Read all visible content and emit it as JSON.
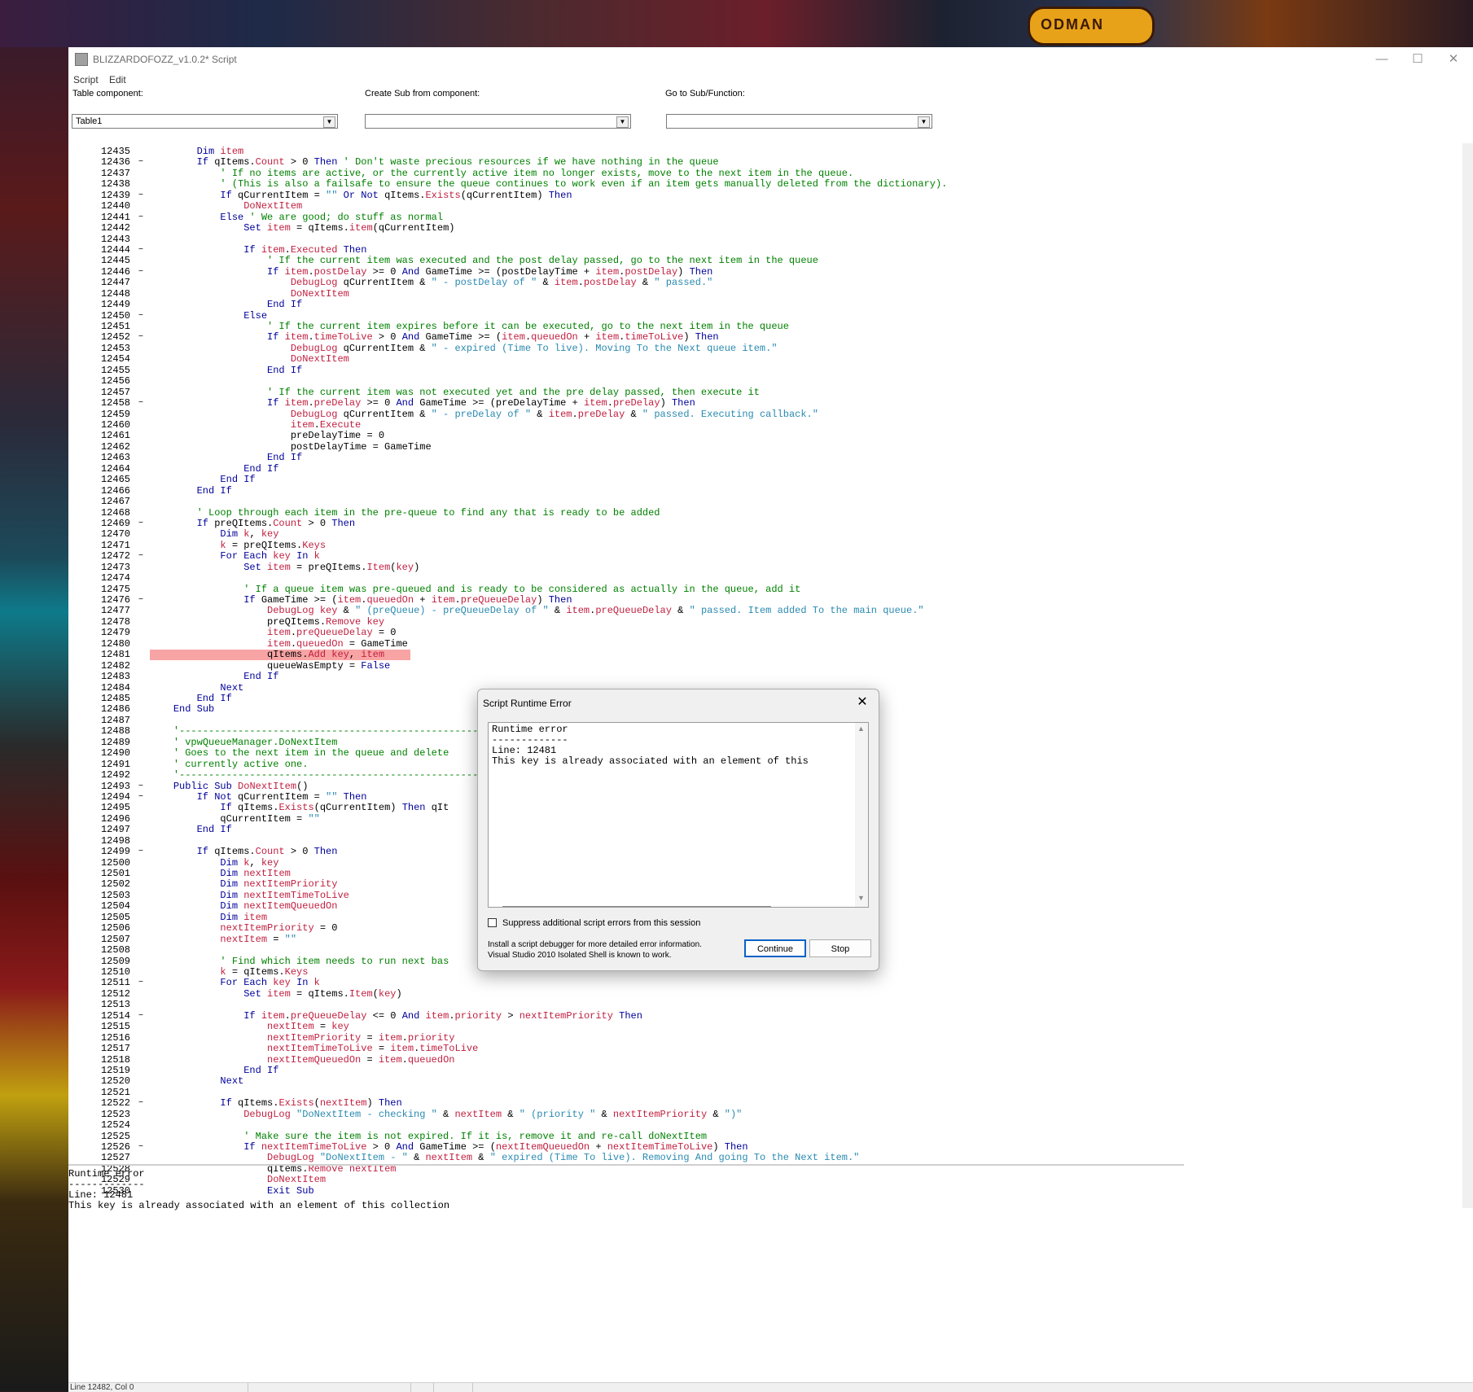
{
  "window": {
    "title": "BLIZZARDOFOZZ_v1.0.2* Script",
    "minimize": "—",
    "maximize": "☐",
    "close": "✕"
  },
  "desktop_badge_text": "ODMAN",
  "menu": {
    "script": "Script",
    "edit": "Edit"
  },
  "toolbar": {
    "table_component_label": "Table component:",
    "table_component_value": "Table1",
    "create_sub_label": "Create Sub from component:",
    "create_sub_value": "",
    "goto_sub_label": "Go to Sub/Function:",
    "goto_sub_value": ""
  },
  "code_lines": [
    {
      "n": "12435",
      "f": "",
      "t": "        Dim item"
    },
    {
      "n": "12436",
      "f": "−",
      "t": "        If qItems.Count > 0 Then ' Don't waste precious resources if we have nothing in the queue"
    },
    {
      "n": "12437",
      "f": "",
      "t": "            ' If no items are active, or the currently active item no longer exists, move to the next item in the queue."
    },
    {
      "n": "12438",
      "f": "",
      "t": "            ' (This is also a failsafe to ensure the queue continues to work even if an item gets manually deleted from the dictionary)."
    },
    {
      "n": "12439",
      "f": "−",
      "t": "            If qCurrentItem = \"\" Or Not qItems.Exists(qCurrentItem) Then"
    },
    {
      "n": "12440",
      "f": "",
      "t": "                DoNextItem"
    },
    {
      "n": "12441",
      "f": "−",
      "t": "            Else ' We are good; do stuff as normal"
    },
    {
      "n": "12442",
      "f": "",
      "t": "                Set item = qItems.item(qCurrentItem)"
    },
    {
      "n": "12443",
      "f": "",
      "t": ""
    },
    {
      "n": "12444",
      "f": "−",
      "t": "                If item.Executed Then"
    },
    {
      "n": "12445",
      "f": "",
      "t": "                    ' If the current item was executed and the post delay passed, go to the next item in the queue"
    },
    {
      "n": "12446",
      "f": "−",
      "t": "                    If item.postDelay >= 0 And GameTime >= (postDelayTime + item.postDelay) Then"
    },
    {
      "n": "12447",
      "f": "",
      "t": "                        DebugLog qCurrentItem & \" - postDelay of \" & item.postDelay & \" passed.\""
    },
    {
      "n": "12448",
      "f": "",
      "t": "                        DoNextItem"
    },
    {
      "n": "12449",
      "f": "",
      "t": "                    End If"
    },
    {
      "n": "12450",
      "f": "−",
      "t": "                Else"
    },
    {
      "n": "12451",
      "f": "",
      "t": "                    ' If the current item expires before it can be executed, go to the next item in the queue"
    },
    {
      "n": "12452",
      "f": "−",
      "t": "                    If item.timeToLive > 0 And GameTime >= (item.queuedOn + item.timeToLive) Then"
    },
    {
      "n": "12453",
      "f": "",
      "t": "                        DebugLog qCurrentItem & \" - expired (Time To live). Moving To the Next queue item.\""
    },
    {
      "n": "12454",
      "f": "",
      "t": "                        DoNextItem"
    },
    {
      "n": "12455",
      "f": "",
      "t": "                    End If"
    },
    {
      "n": "12456",
      "f": "",
      "t": ""
    },
    {
      "n": "12457",
      "f": "",
      "t": "                    ' If the current item was not executed yet and the pre delay passed, then execute it"
    },
    {
      "n": "12458",
      "f": "−",
      "t": "                    If item.preDelay >= 0 And GameTime >= (preDelayTime + item.preDelay) Then"
    },
    {
      "n": "12459",
      "f": "",
      "t": "                        DebugLog qCurrentItem & \" - preDelay of \" & item.preDelay & \" passed. Executing callback.\""
    },
    {
      "n": "12460",
      "f": "",
      "t": "                        item.Execute"
    },
    {
      "n": "12461",
      "f": "",
      "t": "                        preDelayTime = 0"
    },
    {
      "n": "12462",
      "f": "",
      "t": "                        postDelayTime = GameTime"
    },
    {
      "n": "12463",
      "f": "",
      "t": "                    End If"
    },
    {
      "n": "12464",
      "f": "",
      "t": "                End If"
    },
    {
      "n": "12465",
      "f": "",
      "t": "            End If"
    },
    {
      "n": "12466",
      "f": "",
      "t": "        End If"
    },
    {
      "n": "12467",
      "f": "",
      "t": ""
    },
    {
      "n": "12468",
      "f": "",
      "t": "        ' Loop through each item in the pre-queue to find any that is ready to be added"
    },
    {
      "n": "12469",
      "f": "−",
      "t": "        If preQItems.Count > 0 Then"
    },
    {
      "n": "12470",
      "f": "",
      "t": "            Dim k, key"
    },
    {
      "n": "12471",
      "f": "",
      "t": "            k = preQItems.Keys"
    },
    {
      "n": "12472",
      "f": "−",
      "t": "            For Each key In k"
    },
    {
      "n": "12473",
      "f": "",
      "t": "                Set item = preQItems.Item(key)"
    },
    {
      "n": "12474",
      "f": "",
      "t": ""
    },
    {
      "n": "12475",
      "f": "",
      "t": "                ' If a queue item was pre-queued and is ready to be considered as actually in the queue, add it"
    },
    {
      "n": "12476",
      "f": "−",
      "t": "                If GameTime >= (item.queuedOn + item.preQueueDelay) Then"
    },
    {
      "n": "12477",
      "f": "",
      "t": "                    DebugLog key & \" (preQueue) - preQueueDelay of \" & item.preQueueDelay & \" passed. Item added To the main queue.\""
    },
    {
      "n": "12478",
      "f": "",
      "t": "                    preQItems.Remove key"
    },
    {
      "n": "12479",
      "f": "",
      "t": "                    item.preQueueDelay = 0"
    },
    {
      "n": "12480",
      "f": "",
      "t": "                    item.queuedOn = GameTime"
    },
    {
      "n": "12481",
      "f": "",
      "t": "                    qItems.Add key, item",
      "hl": true
    },
    {
      "n": "12482",
      "f": "",
      "t": "                    queueWasEmpty = False"
    },
    {
      "n": "12483",
      "f": "",
      "t": "                End If"
    },
    {
      "n": "12484",
      "f": "",
      "t": "            Next"
    },
    {
      "n": "12485",
      "f": "",
      "t": "        End If"
    },
    {
      "n": "12486",
      "f": "",
      "t": "    End Sub"
    },
    {
      "n": "12487",
      "f": "",
      "t": ""
    },
    {
      "n": "12488",
      "f": "",
      "t": "    '----------------------------------------------------------------------------------------"
    },
    {
      "n": "12489",
      "f": "",
      "t": "    ' vpwQueueManager.DoNextItem"
    },
    {
      "n": "12490",
      "f": "",
      "t": "    ' Goes to the next item in the queue and delete"
    },
    {
      "n": "12491",
      "f": "",
      "t": "    ' currently active one."
    },
    {
      "n": "12492",
      "f": "",
      "t": "    '----------------------------------------------------------------------------------------"
    },
    {
      "n": "12493",
      "f": "−",
      "t": "    Public Sub DoNextItem()"
    },
    {
      "n": "12494",
      "f": "−",
      "t": "        If Not qCurrentItem = \"\" Then"
    },
    {
      "n": "12495",
      "f": "",
      "t": "            If qItems.Exists(qCurrentItem) Then qIt                                                  eue if it still exists"
    },
    {
      "n": "12496",
      "f": "",
      "t": "            qCurrentItem = \"\""
    },
    {
      "n": "12497",
      "f": "",
      "t": "        End If"
    },
    {
      "n": "12498",
      "f": "",
      "t": ""
    },
    {
      "n": "12499",
      "f": "−",
      "t": "        If qItems.Count > 0 Then"
    },
    {
      "n": "12500",
      "f": "",
      "t": "            Dim k, key"
    },
    {
      "n": "12501",
      "f": "",
      "t": "            Dim nextItem"
    },
    {
      "n": "12502",
      "f": "",
      "t": "            Dim nextItemPriority"
    },
    {
      "n": "12503",
      "f": "",
      "t": "            Dim nextItemTimeToLive"
    },
    {
      "n": "12504",
      "f": "",
      "t": "            Dim nextItemQueuedOn"
    },
    {
      "n": "12505",
      "f": "",
      "t": "            Dim item"
    },
    {
      "n": "12506",
      "f": "",
      "t": "            nextItemPriority = 0"
    },
    {
      "n": "12507",
      "f": "",
      "t": "            nextItem = \"\""
    },
    {
      "n": "12508",
      "f": "",
      "t": ""
    },
    {
      "n": "12509",
      "f": "",
      "t": "            ' Find which item needs to run next bas                                                  n active preQueueDelay)"
    },
    {
      "n": "12510",
      "f": "",
      "t": "            k = qItems.Keys"
    },
    {
      "n": "12511",
      "f": "−",
      "t": "            For Each key In k"
    },
    {
      "n": "12512",
      "f": "",
      "t": "                Set item = qItems.Item(key)"
    },
    {
      "n": "12513",
      "f": "",
      "t": ""
    },
    {
      "n": "12514",
      "f": "−",
      "t": "                If item.preQueueDelay <= 0 And item.priority > nextItemPriority Then"
    },
    {
      "n": "12515",
      "f": "",
      "t": "                    nextItem = key"
    },
    {
      "n": "12516",
      "f": "",
      "t": "                    nextItemPriority = item.priority"
    },
    {
      "n": "12517",
      "f": "",
      "t": "                    nextItemTimeToLive = item.timeToLive"
    },
    {
      "n": "12518",
      "f": "",
      "t": "                    nextItemQueuedOn = item.queuedOn"
    },
    {
      "n": "12519",
      "f": "",
      "t": "                End If"
    },
    {
      "n": "12520",
      "f": "",
      "t": "            Next"
    },
    {
      "n": "12521",
      "f": "",
      "t": ""
    },
    {
      "n": "12522",
      "f": "−",
      "t": "            If qItems.Exists(nextItem) Then"
    },
    {
      "n": "12523",
      "f": "",
      "t": "                DebugLog \"DoNextItem - checking \" & nextItem & \" (priority \" & nextItemPriority & \")\""
    },
    {
      "n": "12524",
      "f": "",
      "t": ""
    },
    {
      "n": "12525",
      "f": "",
      "t": "                ' Make sure the item is not expired. If it is, remove it and re-call doNextItem"
    },
    {
      "n": "12526",
      "f": "−",
      "t": "                If nextItemTimeToLive > 0 And GameTime >= (nextItemQueuedOn + nextItemTimeToLive) Then"
    },
    {
      "n": "12527",
      "f": "",
      "t": "                    DebugLog \"DoNextItem - \" & nextItem & \" expired (Time To live). Removing And going To the Next item.\""
    },
    {
      "n": "12528",
      "f": "",
      "t": "                    qItems.Remove nextItem"
    },
    {
      "n": "12529",
      "f": "",
      "t": "                    DoNextItem"
    },
    {
      "n": "12530",
      "f": "",
      "t": "                    Exit Sub"
    }
  ],
  "output": {
    "line1": "Runtime error",
    "line2": "-------------",
    "line3": "Line: 12481",
    "line4": "This key is already associated with an element of this collection"
  },
  "status": {
    "position": "Line 12482, Col 0"
  },
  "dialog": {
    "title": "Script Runtime Error",
    "close": "✕",
    "text1": "Runtime error",
    "text2": "-------------",
    "text3": "Line: 12481",
    "text4": "This key is already associated with an element of this",
    "suppress_label": "Suppress additional script errors from this session",
    "suppress_checked": false,
    "info1": "Install a script debugger for more detailed error information.",
    "info2": "Visual Studio 2010 Isolated Shell is known to work.",
    "continue_label": "Continue",
    "stop_label": "Stop"
  },
  "colors": {
    "keyword": "#00009a",
    "comment": "#008000",
    "string": "#2a8ab0",
    "identifier": "#c02040",
    "error_highlight": "#f8a4a4",
    "default_button_border": "#0a62c8"
  }
}
